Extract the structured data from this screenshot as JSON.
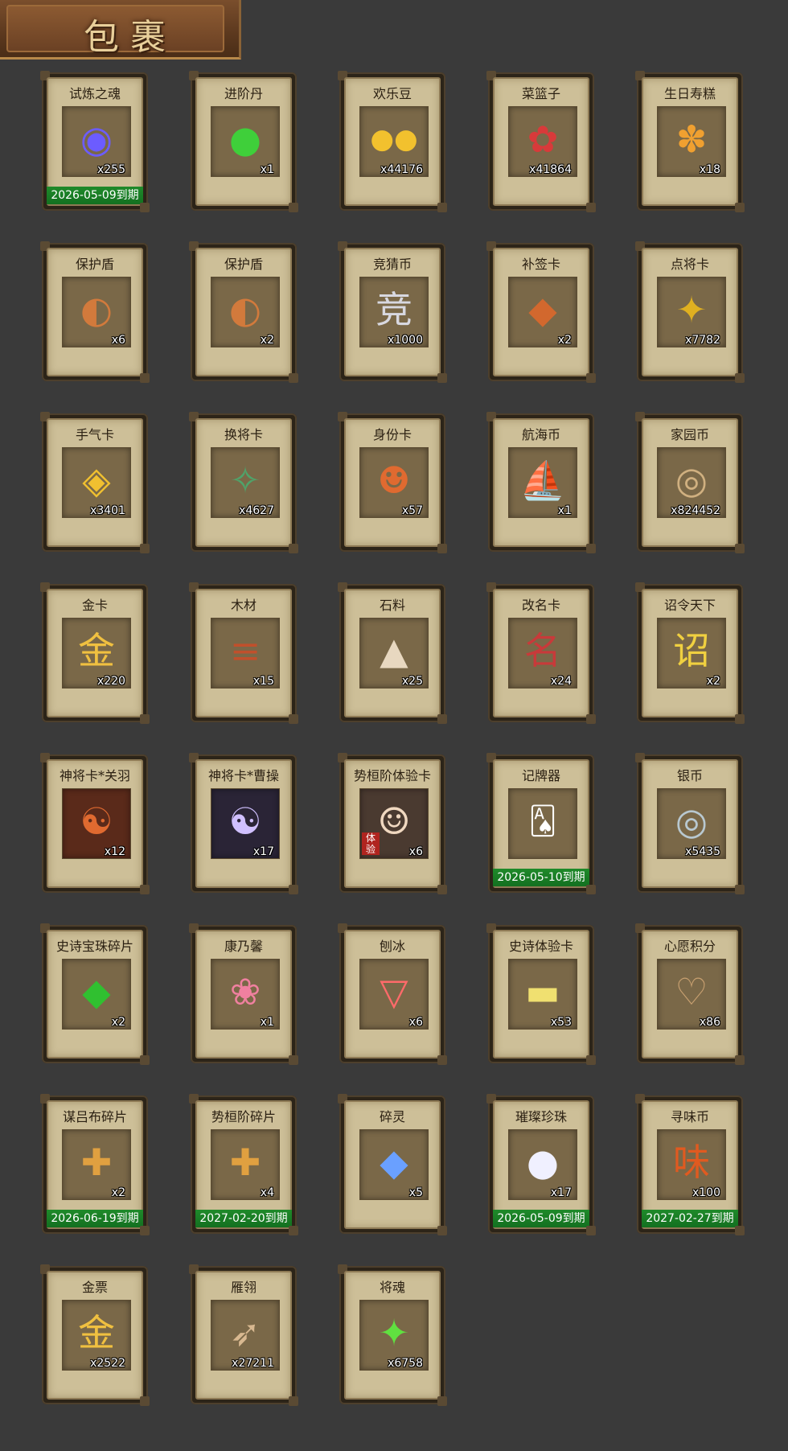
{
  "header": {
    "title": "包裹"
  },
  "items": [
    {
      "name": "试炼之魂",
      "count": "x255",
      "expiry": "2026-05-09到期",
      "icon": "soul-orb-icon",
      "glyph": "◉",
      "color": "#6c5cff",
      "bg": "#7a6848"
    },
    {
      "name": "进阶丹",
      "count": "x1",
      "expiry": "",
      "icon": "green-pill-icon",
      "glyph": "●",
      "color": "#3fcf3a",
      "bg": "#7a6848"
    },
    {
      "name": "欢乐豆",
      "count": "x44176",
      "expiry": "",
      "icon": "gold-beans-icon",
      "glyph": "●●",
      "color": "#f2c12e",
      "bg": "#7a6848"
    },
    {
      "name": "菜篮子",
      "count": "x41864",
      "expiry": "",
      "icon": "basket-icon",
      "glyph": "✿",
      "color": "#d83a3a",
      "bg": "#7a6848"
    },
    {
      "name": "生日寿糕",
      "count": "x18",
      "expiry": "",
      "icon": "cake-icon",
      "glyph": "✽",
      "color": "#f0a030",
      "bg": "#7a6848"
    },
    {
      "name": "保护盾",
      "count": "x6",
      "expiry": "",
      "icon": "shield-icon",
      "glyph": "◐",
      "color": "#d27a3c",
      "bg": "#7a6848"
    },
    {
      "name": "保护盾",
      "count": "x2",
      "expiry": "",
      "icon": "shield-icon",
      "glyph": "◐",
      "color": "#d27a3c",
      "bg": "#7a6848"
    },
    {
      "name": "竞猜币",
      "count": "x1000",
      "expiry": "",
      "icon": "silver-coin-icon",
      "glyph": "竞",
      "color": "#d8d8e0",
      "bg": "#7a6848"
    },
    {
      "name": "补签卡",
      "count": "x2",
      "expiry": "",
      "icon": "tag-card-icon",
      "glyph": "◆",
      "color": "#d2682e",
      "bg": "#7a6848"
    },
    {
      "name": "点将卡",
      "count": "x7782",
      "expiry": "",
      "icon": "general-card-icon",
      "glyph": "✦",
      "color": "#e0b020",
      "bg": "#7a6848"
    },
    {
      "name": "手气卡",
      "count": "x3401",
      "expiry": "",
      "icon": "luck-card-icon",
      "glyph": "◈",
      "color": "#f0c030",
      "bg": "#7a6848"
    },
    {
      "name": "换将卡",
      "count": "x4627",
      "expiry": "",
      "icon": "swap-card-icon",
      "glyph": "✧",
      "color": "#4fa36a",
      "bg": "#7a6848"
    },
    {
      "name": "身份卡",
      "count": "x57",
      "expiry": "",
      "icon": "mask-card-icon",
      "glyph": "☻",
      "color": "#e06a30",
      "bg": "#7a6848"
    },
    {
      "name": "航海币",
      "count": "x1",
      "expiry": "",
      "icon": "boat-coin-icon",
      "glyph": "⛵",
      "color": "#c8d4e8",
      "bg": "#7a6848"
    },
    {
      "name": "家园币",
      "count": "x824452",
      "expiry": "",
      "icon": "home-coin-icon",
      "glyph": "◎",
      "color": "#d0b080",
      "bg": "#7a6848"
    },
    {
      "name": "金卡",
      "count": "x220",
      "expiry": "",
      "icon": "gold-card-icon",
      "glyph": "金",
      "color": "#f0c040",
      "bg": "#7a6848"
    },
    {
      "name": "木材",
      "count": "x15",
      "expiry": "",
      "icon": "wood-icon",
      "glyph": "≡",
      "color": "#c0502c",
      "bg": "#7a6848"
    },
    {
      "name": "石料",
      "count": "x25",
      "expiry": "",
      "icon": "stone-icon",
      "glyph": "▲",
      "color": "#e8d8c0",
      "bg": "#7a6848"
    },
    {
      "name": "改名卡",
      "count": "x24",
      "expiry": "",
      "icon": "rename-card-icon",
      "glyph": "名",
      "color": "#c83a3a",
      "bg": "#7a6848"
    },
    {
      "name": "诏令天下",
      "count": "x2",
      "expiry": "",
      "icon": "decree-scroll-icon",
      "glyph": "诏",
      "color": "#f0d040",
      "bg": "#7a6848"
    },
    {
      "name": "神将卡*关羽",
      "count": "x12",
      "expiry": "",
      "icon": "guanyu-portrait-icon",
      "glyph": "☯",
      "color": "#e06a30",
      "bg": "#5a2a1a"
    },
    {
      "name": "神将卡*曹操",
      "count": "x17",
      "expiry": "",
      "icon": "caocao-portrait-icon",
      "glyph": "☯",
      "color": "#d0c0ff",
      "bg": "#2a2436"
    },
    {
      "name": "势桓阶体验卡",
      "count": "x6",
      "expiry": "",
      "icon": "hero-trial-portrait-icon",
      "glyph": "☺",
      "color": "#f0d8c0",
      "bg": "#4a3a30",
      "badge": "体验"
    },
    {
      "name": "记牌器",
      "count": "",
      "expiry": "2026-05-10到期",
      "icon": "playing-cards-icon",
      "glyph": "🂡",
      "color": "#ffffff",
      "bg": "#7a6848"
    },
    {
      "name": "银币",
      "count": "x5435",
      "expiry": "",
      "icon": "silver-coins-icon",
      "glyph": "◎",
      "color": "#b8c8d0",
      "bg": "#7a6848"
    },
    {
      "name": "史诗宝珠碎片",
      "count": "x2",
      "expiry": "",
      "icon": "green-shard-icon",
      "glyph": "◆",
      "color": "#30c030",
      "bg": "#7a6848"
    },
    {
      "name": "康乃馨",
      "count": "x1",
      "expiry": "",
      "icon": "carnation-icon",
      "glyph": "❀",
      "color": "#f080a0",
      "bg": "#7a6848"
    },
    {
      "name": "刨冰",
      "count": "x6",
      "expiry": "",
      "icon": "shaved-ice-icon",
      "glyph": "▽",
      "color": "#ff6a6a",
      "bg": "#7a6848"
    },
    {
      "name": "史诗体验卡",
      "count": "x53",
      "expiry": "",
      "icon": "epic-trial-card-icon",
      "glyph": "▬",
      "color": "#f0e070",
      "bg": "#7a6848"
    },
    {
      "name": "心愿积分",
      "count": "x86",
      "expiry": "",
      "icon": "heart-coin-icon",
      "glyph": "♡",
      "color": "#c8a070",
      "bg": "#7a6848"
    },
    {
      "name": "谋吕布碎片",
      "count": "x2",
      "expiry": "2026-06-19到期",
      "icon": "lubu-puzzle-icon",
      "glyph": "✚",
      "color": "#e0a040",
      "bg": "#7a6848"
    },
    {
      "name": "势桓阶碎片",
      "count": "x4",
      "expiry": "2027-02-20到期",
      "icon": "hero-puzzle-icon",
      "glyph": "✚",
      "color": "#e0a040",
      "bg": "#7a6848"
    },
    {
      "name": "碎灵",
      "count": "x5",
      "expiry": "",
      "icon": "crystal-shard-icon",
      "glyph": "◆",
      "color": "#6aa0ff",
      "bg": "#7a6848"
    },
    {
      "name": "璀璨珍珠",
      "count": "x17",
      "expiry": "2026-05-09到期",
      "icon": "pearl-icon",
      "glyph": "●",
      "color": "#f0f0ff",
      "bg": "#7a6848"
    },
    {
      "name": "寻味币",
      "count": "x100",
      "expiry": "2027-02-27到期",
      "icon": "taste-coin-icon",
      "glyph": "味",
      "color": "#e05a20",
      "bg": "#7a6848"
    },
    {
      "name": "金票",
      "count": "x2522",
      "expiry": "",
      "icon": "gold-ticket-icon",
      "glyph": "金",
      "color": "#f0c040",
      "bg": "#7a6848"
    },
    {
      "name": "雁翎",
      "count": "x27211",
      "expiry": "",
      "icon": "feather-icon",
      "glyph": "➶",
      "color": "#d8b890",
      "bg": "#7a6848"
    },
    {
      "name": "将魂",
      "count": "x6758",
      "expiry": "",
      "icon": "green-spirit-icon",
      "glyph": "✦",
      "color": "#60e040",
      "bg": "#7a6848"
    }
  ]
}
